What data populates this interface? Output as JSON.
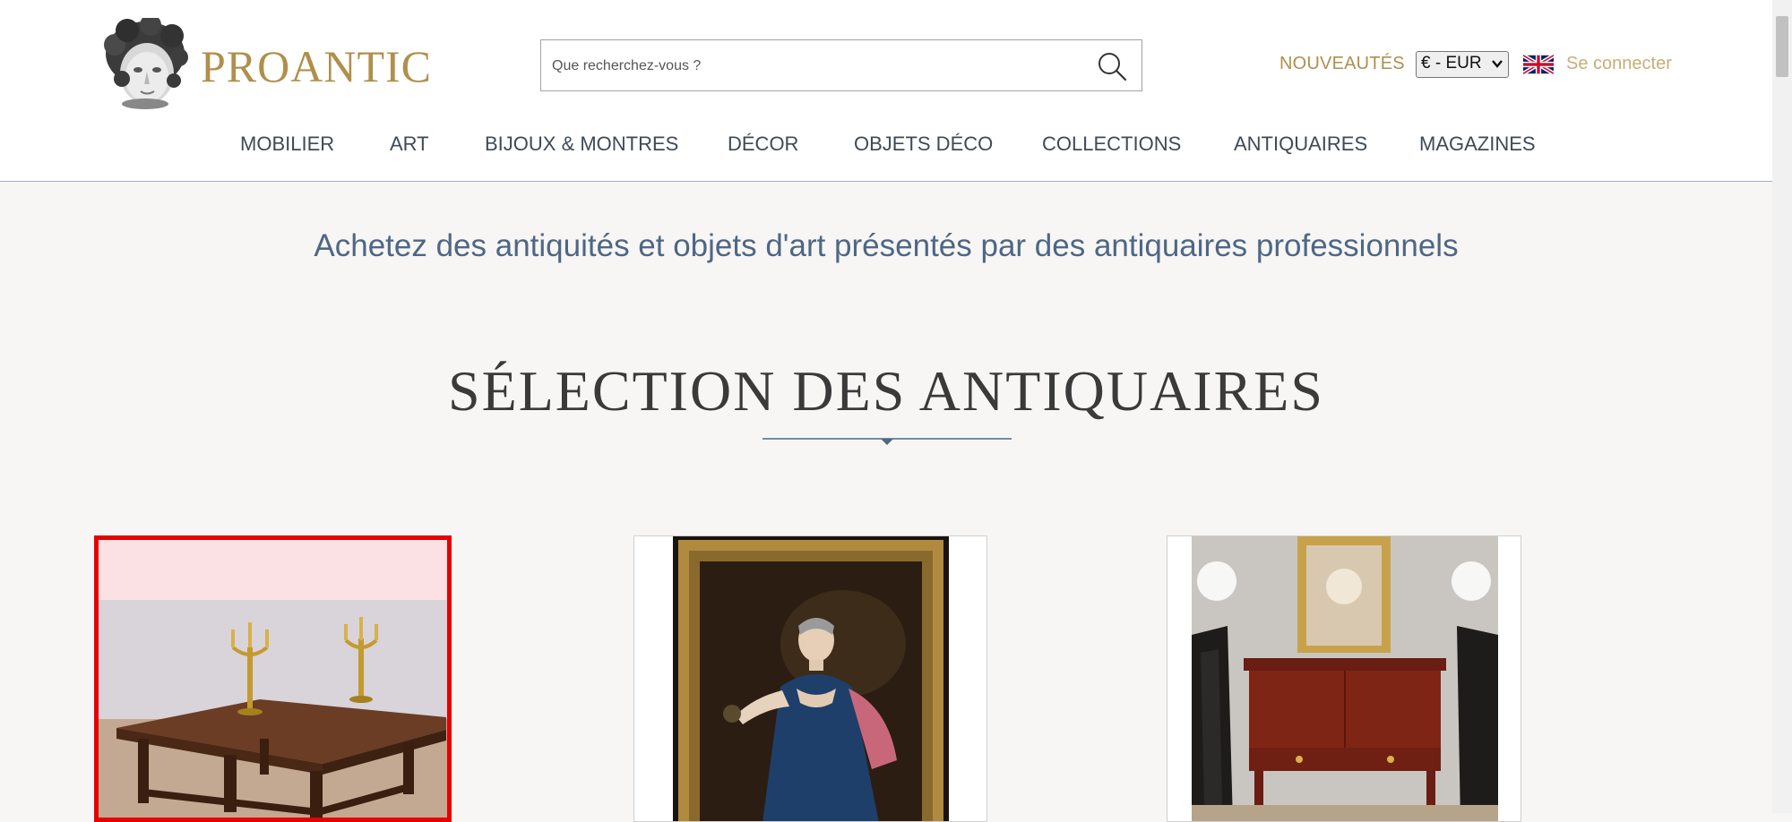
{
  "header": {
    "brand": "PROANTIC",
    "search_placeholder": "Que recherchez-vous ?",
    "new_label": "NOUVEAUTÉS",
    "currency": "€ - EUR",
    "login_label": "Se connecter"
  },
  "nav": [
    "MOBILIER",
    "ART",
    "BIJOUX & MONTRES",
    "DÉCOR",
    "OBJETS DÉCO",
    "COLLECTIONS",
    "ANTIQUAIRES",
    "MAGAZINES"
  ],
  "main": {
    "tagline": "Achetez des antiquités et objets d'art présentés par des antiquaires professionnels",
    "section_title": "SÉLECTION DES ANTIQUAIRES"
  },
  "icons": {
    "logo": "cherub-head-logo",
    "search": "search-icon",
    "flag": "uk-flag-icon"
  },
  "colors": {
    "brand_gold": "#b08f4c",
    "nav_text": "#3f4a57",
    "tagline_blue": "#4e6785",
    "selection_red": "#e60000",
    "page_bg": "#f7f6f4"
  }
}
